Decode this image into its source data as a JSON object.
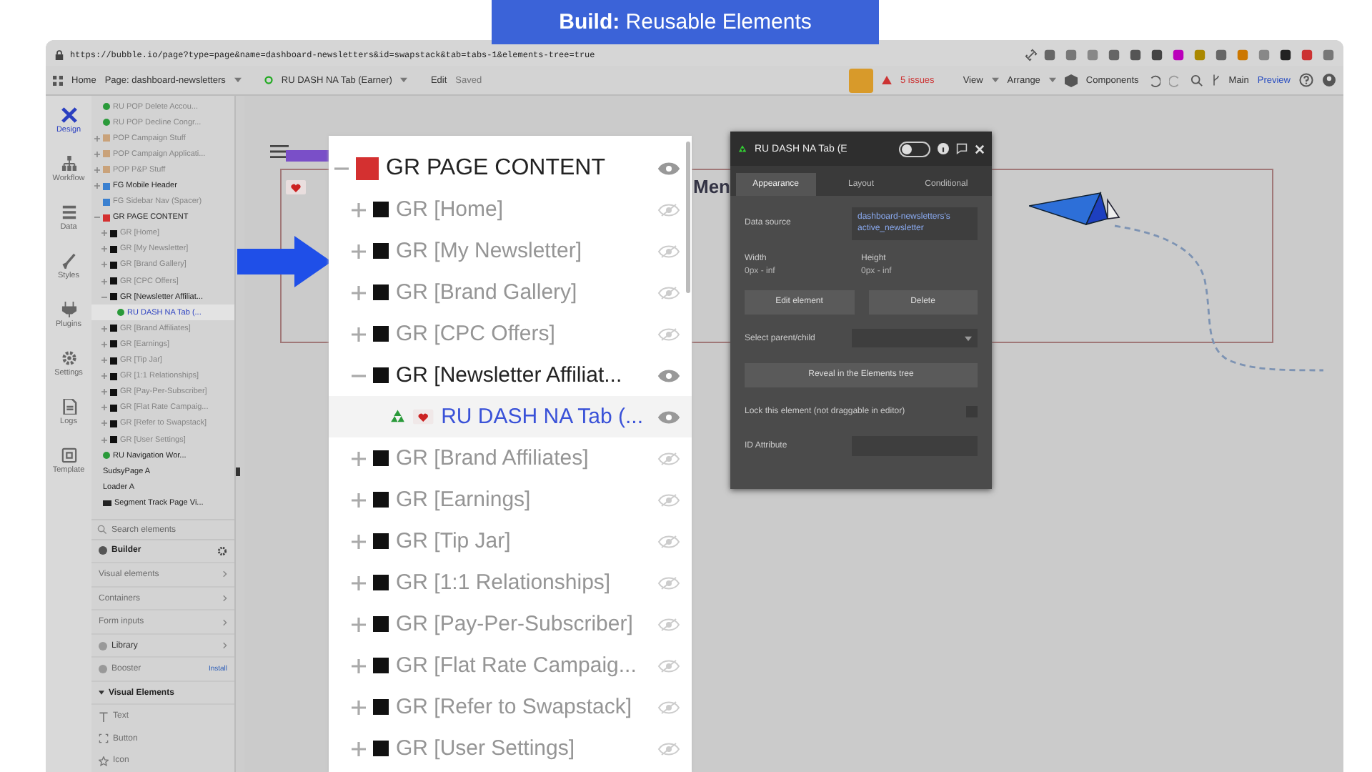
{
  "banner": {
    "title": "**Build:** Reusable Elements"
  },
  "browser": {
    "url": "https://bubble.io/page?type=page&name=dashboard-newsletters&id=swapstack&tab=tabs-1&elements-tree=true"
  },
  "toolbar": {
    "home": "Home",
    "page": "Page: dashboard-newsletters",
    "element": "RU DASH NA Tab (Earner)",
    "edit": "Edit",
    "saved": "Saved",
    "issues": "5 issues",
    "view": "View",
    "arrange": "Arrange",
    "components": "Components",
    "branch": "Main",
    "preview": "Preview"
  },
  "rail": [
    {
      "label": "Design",
      "selected": true
    },
    {
      "label": "Workflow",
      "selected": false
    },
    {
      "label": "Data",
      "selected": false
    },
    {
      "label": "Styles",
      "selected": false
    },
    {
      "label": "Plugins",
      "selected": false
    },
    {
      "label": "Settings",
      "selected": false
    },
    {
      "label": "Logs",
      "selected": false
    },
    {
      "label": "Template",
      "selected": false
    }
  ],
  "tree": {
    "items": [
      {
        "label": "RU POP Delete Accou...",
        "kind": "reusable",
        "visible": false,
        "selected": false
      },
      {
        "label": "RU POP Decline Congr...",
        "kind": "reusable",
        "visible": false,
        "selected": false
      },
      {
        "label": "POP Campaign Stuff",
        "kind": "popup",
        "visible": false,
        "expanded": false,
        "selected": false
      },
      {
        "label": "POP Campaign Applicati...",
        "kind": "popup",
        "visible": false,
        "expanded": false,
        "selected": false
      },
      {
        "label": "POP P&P Stuff",
        "kind": "popup",
        "visible": false,
        "expanded": false,
        "selected": false
      },
      {
        "label": "FG Mobile Header",
        "kind": "floating",
        "visible": true,
        "expanded": false,
        "selected": false
      },
      {
        "label": "FG Sidebar Nav (Spacer)",
        "kind": "floating",
        "visible": false,
        "selected": false
      },
      {
        "label": "GR PAGE CONTENT",
        "kind": "page",
        "visible": true,
        "expanded": true,
        "selected": false,
        "children": [
          {
            "label": "GR [Home]",
            "kind": "group",
            "visible": false,
            "expanded": false,
            "selected": false
          },
          {
            "label": "GR [My Newsletter]",
            "kind": "group",
            "visible": false,
            "expanded": false,
            "selected": false
          },
          {
            "label": "GR [Brand Gallery]",
            "kind": "group",
            "visible": false,
            "expanded": false,
            "selected": false
          },
          {
            "label": "GR [CPC Offers]",
            "kind": "group",
            "visible": false,
            "expanded": false,
            "selected": false
          },
          {
            "label": "GR [Newsletter Affiliat...",
            "kind": "group",
            "visible": true,
            "expanded": true,
            "selected": false,
            "children": [
              {
                "label": "RU DASH NA Tab (...",
                "kind": "reusable",
                "visible": true,
                "selected": true
              }
            ]
          },
          {
            "label": "GR [Brand Affiliates]",
            "kind": "group",
            "visible": false,
            "expanded": false,
            "selected": false
          },
          {
            "label": "GR [Earnings]",
            "kind": "group",
            "visible": false,
            "expanded": false,
            "selected": false
          },
          {
            "label": "GR [Tip Jar]",
            "kind": "group",
            "visible": false,
            "expanded": false,
            "selected": false
          },
          {
            "label": "GR [1:1 Relationships]",
            "kind": "group",
            "visible": false,
            "expanded": false,
            "selected": false
          },
          {
            "label": "GR [Pay-Per-Subscriber]",
            "kind": "group",
            "visible": false,
            "expanded": false,
            "selected": false
          },
          {
            "label": "GR [Flat Rate Campaig...",
            "kind": "group",
            "visible": false,
            "expanded": false,
            "selected": false
          },
          {
            "label": "GR [Refer to Swapstack]",
            "kind": "group",
            "visible": false,
            "expanded": false,
            "selected": false
          },
          {
            "label": "GR [User Settings]",
            "kind": "group",
            "visible": false,
            "expanded": false,
            "selected": false
          }
        ]
      },
      {
        "label": "RU Navigation Wor...",
        "kind": "reusable",
        "visible": true,
        "selected": false
      },
      {
        "label": "SudsyPage A",
        "kind": "plain",
        "visible": true,
        "selected": false
      },
      {
        "label": "Loader A",
        "kind": "plain",
        "visible": true,
        "selected": false
      },
      {
        "label": "Segment Track Page Vi...",
        "kind": "tracker",
        "visible": true,
        "selected": false
      }
    ]
  },
  "search": {
    "placeholder": "Search elements"
  },
  "palette": [
    {
      "label": "Builder",
      "kind": "header"
    },
    {
      "label": "Visual elements",
      "kind": "link"
    },
    {
      "label": "Containers",
      "kind": "link"
    },
    {
      "label": "Form inputs",
      "kind": "link"
    },
    {
      "label": "Library",
      "kind": "library"
    },
    {
      "label": "Booster",
      "kind": "booster",
      "action": "Install"
    },
    {
      "label": "Visual Elements",
      "kind": "section"
    },
    {
      "label": "Text",
      "kind": "text"
    },
    {
      "label": "Button",
      "kind": "button"
    },
    {
      "label": "Icon",
      "kind": "icon"
    }
  ],
  "canvas": {
    "heading": "Men"
  },
  "zoomed_tree": {
    "items": [
      {
        "label": "GR PAGE CONTENT",
        "kind": "page",
        "visible": true,
        "expanded": true,
        "selected": false,
        "children": [
          {
            "label": "GR [Home]",
            "kind": "group",
            "visible": false,
            "expanded": false,
            "selected": false
          },
          {
            "label": "GR [My Newsletter]",
            "kind": "group",
            "visible": false,
            "expanded": false,
            "selected": false
          },
          {
            "label": "GR [Brand Gallery]",
            "kind": "group",
            "visible": false,
            "expanded": false,
            "selected": false
          },
          {
            "label": "GR [CPC Offers]",
            "kind": "group",
            "visible": false,
            "expanded": false,
            "selected": false
          },
          {
            "label": "GR [Newsletter Affiliat...",
            "kind": "group",
            "visible": true,
            "expanded": true,
            "selected": false,
            "children": [
              {
                "label": "RU DASH NA Tab (...",
                "kind": "reusable",
                "visible": true,
                "selected": true
              }
            ]
          },
          {
            "label": "GR [Brand Affiliates]",
            "kind": "group",
            "visible": false,
            "expanded": false,
            "selected": false
          },
          {
            "label": "GR [Earnings]",
            "kind": "group",
            "visible": false,
            "expanded": false,
            "selected": false
          },
          {
            "label": "GR [Tip Jar]",
            "kind": "group",
            "visible": false,
            "expanded": false,
            "selected": false
          },
          {
            "label": "GR [1:1 Relationships]",
            "kind": "group",
            "visible": false,
            "expanded": false,
            "selected": false
          },
          {
            "label": "GR [Pay-Per-Subscriber]",
            "kind": "group",
            "visible": false,
            "expanded": false,
            "selected": false
          },
          {
            "label": "GR [Flat Rate Campaig...",
            "kind": "group",
            "visible": false,
            "expanded": false,
            "selected": false
          },
          {
            "label": "GR [Refer to Swapstack]",
            "kind": "group",
            "visible": false,
            "expanded": false,
            "selected": false
          },
          {
            "label": "GR [User Settings]",
            "kind": "group",
            "visible": false,
            "expanded": false,
            "selected": false
          }
        ]
      }
    ]
  },
  "inspector": {
    "title": "RU DASH NA Tab (E",
    "tabs": [
      {
        "label": "Appearance",
        "selected": true
      },
      {
        "label": "Layout",
        "selected": false
      },
      {
        "label": "Conditional",
        "selected": false
      }
    ],
    "data_source_label": "Data source",
    "data_source": "dashboard-newsletters's active_newsletter",
    "width_label": "Width",
    "width": "0px - inf",
    "height_label": "Height",
    "height": "0px - inf",
    "buttons": [
      "Edit element",
      "Delete"
    ],
    "select_label": "Select parent/child",
    "reveal": "Reveal in the Elements tree",
    "lock_label": "Lock this element (not draggable in editor)",
    "locked": false,
    "id_label": "ID Attribute",
    "toggle_on": false
  }
}
